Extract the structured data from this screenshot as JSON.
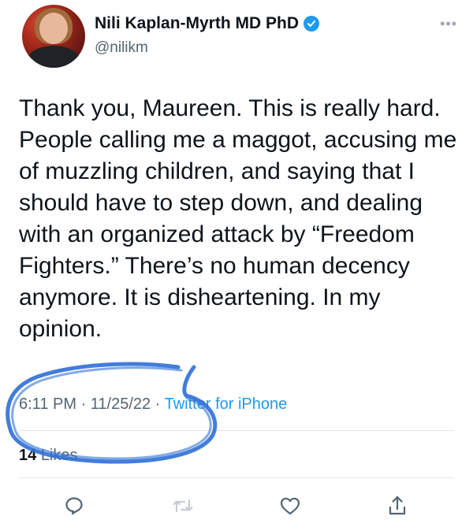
{
  "author": {
    "display_name": "Nili Kaplan-Myrth MD PhD",
    "handle": "@nilikm",
    "verified": true
  },
  "tweet": {
    "text": "Thank you, Maureen. This is really hard. People calling me a maggot, accusing me of muzzling children, and saying that I should have to step down, and dealing with an organized attack by “Freedom Fighters.” There’s no human decency anymore. It is disheartening. In my opinion.",
    "time": "6:11 PM",
    "separator": "·",
    "date": "11/25/22",
    "source": "Twitter for iPhone"
  },
  "engagement": {
    "likes_count": "14",
    "likes_label": "Likes"
  },
  "actions": {
    "reply": "reply-icon",
    "retweet": "retweet-icon",
    "like": "heart-icon",
    "share": "share-icon"
  },
  "colors": {
    "accent": "#1d9bf0",
    "text_primary": "#0f1419",
    "text_secondary": "#536471",
    "annotation_ink": "#2f6fd6"
  }
}
